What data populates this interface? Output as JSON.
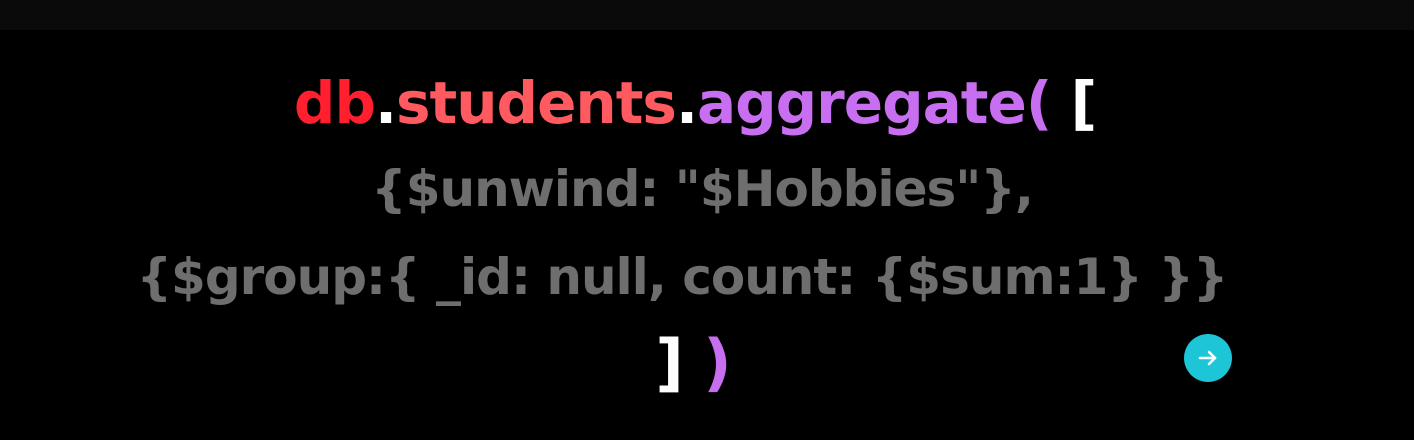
{
  "code": {
    "line1": {
      "db": "db",
      "dot1": ".",
      "students": "students",
      "dot2": ".",
      "aggregate": "aggregate",
      "open_paren": "(",
      "open_bracket": "["
    },
    "line2": "{$unwind: \"$Hobbies\"},",
    "line3": "{$group:{ _id: null, count: {$sum:1} }}",
    "line4": {
      "close_bracket": "]",
      "close_paren": ")"
    }
  },
  "colors": {
    "background": "#000000",
    "db": "#ff1f2e",
    "students": "#ff5a5f",
    "aggregate": "#c86ef0",
    "code_gray": "#6e6e6e",
    "bracket": "#ffffff",
    "next_button": "#1cc6d6"
  },
  "next_button": {
    "icon": "arrow-right-icon"
  }
}
